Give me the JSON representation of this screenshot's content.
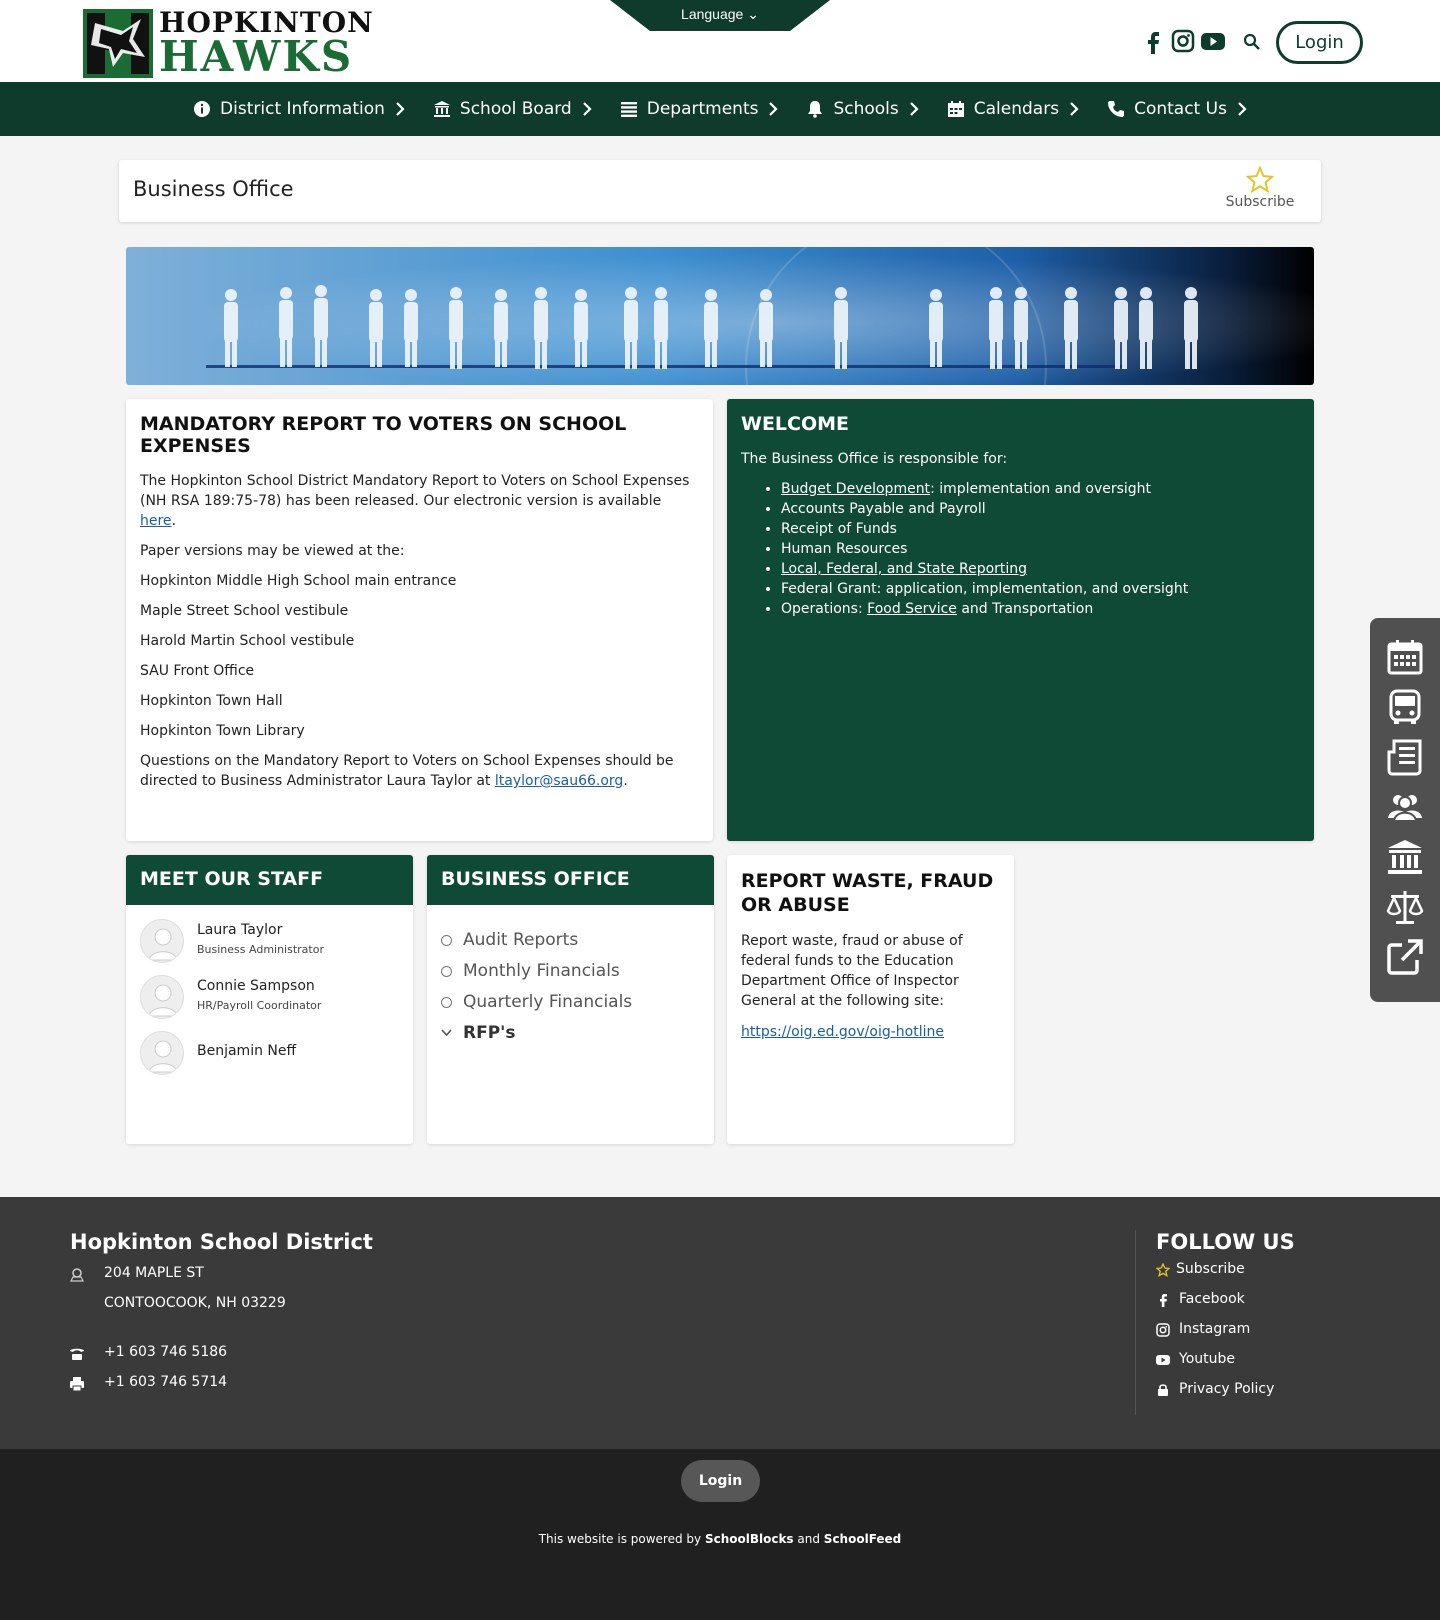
{
  "header": {
    "logo_top": "HOPKINTON",
    "logo_bottom": "HAWKS",
    "language_label": "Language",
    "login_label": "Login"
  },
  "nav": {
    "items": [
      {
        "label": "District Information",
        "icon": "info-icon"
      },
      {
        "label": "School Board",
        "icon": "bank-icon"
      },
      {
        "label": "Departments",
        "icon": "list-icon"
      },
      {
        "label": "Schools",
        "icon": "bell-icon"
      },
      {
        "label": "Calendars",
        "icon": "calendar-icon"
      },
      {
        "label": "Contact Us",
        "icon": "phone-icon"
      }
    ]
  },
  "page": {
    "title": "Business Office",
    "subscribe_label": "Subscribe"
  },
  "report": {
    "title": "MANDATORY REPORT TO VOTERS ON SCHOOL EXPENSES",
    "intro": "The Hopkinton School District Mandatory Report to Voters on School Expenses (NH RSA 189:75-78) has been released.  Our electronic version is available ",
    "intro_link": "here",
    "paper_intro": "Paper versions may be viewed at the:",
    "locations": [
      "Hopkinton Middle High School main entrance",
      "Maple Street School vestibule",
      "Harold Martin School vestibule",
      "SAU Front Office",
      "Hopkinton Town Hall",
      "Hopkinton Town Library"
    ],
    "questions": "Questions on the Mandatory Report to Voters on School Expenses should be directed to Business Administrator Laura Taylor at ",
    "email": "ltaylor@sau66.org"
  },
  "welcome": {
    "title": "WELCOME",
    "intro": "The Business Office is responsible for:",
    "items": [
      {
        "link": "Budget Development",
        "text": ": implementation and oversight"
      },
      {
        "link": "",
        "text": "Accounts Payable and Payroll"
      },
      {
        "link": "",
        "text": "Receipt of Funds"
      },
      {
        "link": "",
        "text": "Human Resources"
      },
      {
        "link": "Local, Federal, and State Reporting",
        "text": ""
      },
      {
        "link": "",
        "text": "Federal Grant: application, implementation, and oversight"
      },
      {
        "prefix": "Operations: ",
        "link": "Food Service",
        "text": " and Transportation"
      }
    ]
  },
  "staff": {
    "title": "MEET OUR STAFF",
    "members": [
      {
        "name": "Laura Taylor",
        "role": "Business Administrator"
      },
      {
        "name": "Connie Sampson",
        "role": "HR/Payroll Coordinator"
      },
      {
        "name": "Benjamin Neff",
        "role": ""
      }
    ]
  },
  "business_office": {
    "title": "BUSINESS OFFICE",
    "items": [
      "Audit Reports",
      "Monthly Financials",
      "Quarterly Financials",
      "RFP's"
    ]
  },
  "waste": {
    "title": "REPORT WASTE, FRAUD OR ABUSE",
    "text": "Report waste, fraud or abuse of federal funds to the Education Department Office of Inspector General at the following site:",
    "link": "https://oig.ed.gov/oig-hotline"
  },
  "quick_links": [
    "calendar-icon",
    "bus-icon",
    "newspaper-icon",
    "users-icon",
    "institution-icon",
    "balance-scale-icon",
    "external-link-icon"
  ],
  "footer": {
    "district": "Hopkinton School District",
    "address1": "204 MAPLE ST",
    "address2": "CONTOOCOOK, NH 03229",
    "phone": "+1 603 746 5186",
    "fax": "+1 603 746 5714",
    "follow_title": "FOLLOW US",
    "links": [
      "Subscribe",
      "Facebook",
      "Instagram",
      "Youtube",
      "Privacy Policy"
    ],
    "login_label": "Login",
    "powered_prefix": "This website is powered by ",
    "powered_a": "SchoolBlocks",
    "powered_and": " and ",
    "powered_b": "SchoolFeed"
  },
  "colors": {
    "brand_green": "#0f3b2c",
    "card_green": "#0f4a36",
    "link_blue": "#1a5ea8",
    "star_yellow": "#e6c32a"
  }
}
